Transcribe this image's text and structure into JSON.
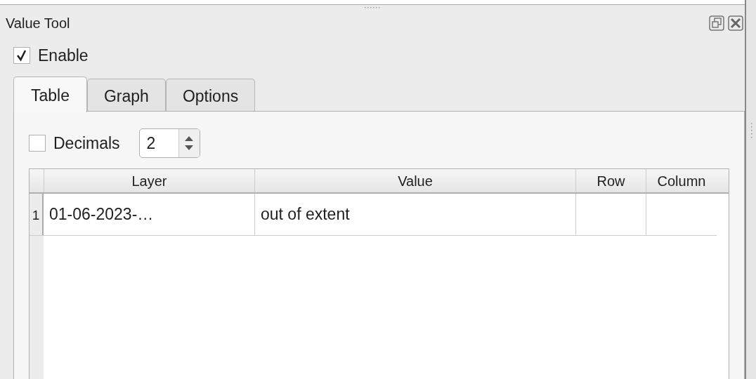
{
  "panel": {
    "title": "Value Tool"
  },
  "enable": {
    "label": "Enable",
    "checked": true
  },
  "tabs": [
    {
      "label": "Table",
      "selected": true
    },
    {
      "label": "Graph",
      "selected": false
    },
    {
      "label": "Options",
      "selected": false
    }
  ],
  "decimals": {
    "label": "Decimals",
    "checked": false,
    "value": "2"
  },
  "table": {
    "columns": [
      "Layer",
      "Value",
      "Row",
      "Column"
    ],
    "rows": [
      {
        "number": "1",
        "cells": [
          "01-06-2023-…",
          "out of extent",
          "",
          ""
        ]
      }
    ]
  }
}
